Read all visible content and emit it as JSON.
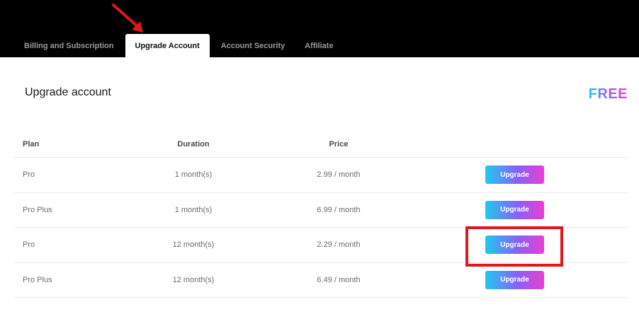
{
  "tabs": [
    {
      "label": "Billing and Subscription",
      "active": false
    },
    {
      "label": "Upgrade Account",
      "active": true
    },
    {
      "label": "Account Security",
      "active": false
    },
    {
      "label": "Affiliate",
      "active": false
    }
  ],
  "page": {
    "title": "Upgrade account",
    "current_plan": "FREE"
  },
  "table": {
    "headers": {
      "plan": "Plan",
      "duration": "Duration",
      "price": "Price"
    },
    "rows": [
      {
        "plan": "Pro",
        "duration": "1 month(s)",
        "price": "2.99 / month",
        "action": "Upgrade"
      },
      {
        "plan": "Pro Plus",
        "duration": "1 month(s)",
        "price": "6.99 / month",
        "action": "Upgrade"
      },
      {
        "plan": "Pro",
        "duration": "12 month(s)",
        "price": "2.29 / month",
        "action": "Upgrade"
      },
      {
        "plan": "Pro Plus",
        "duration": "12 month(s)",
        "price": "6.49 / month",
        "action": "Upgrade"
      }
    ]
  },
  "annotations": {
    "arrow_color": "#e01818",
    "highlight_color": "#e01818",
    "highlighted_row": 2
  },
  "colors": {
    "topbar": "#000000",
    "gradient_start": "#20c9ef",
    "gradient_mid": "#8b5ff6",
    "gradient_end": "#ea3fd2"
  }
}
